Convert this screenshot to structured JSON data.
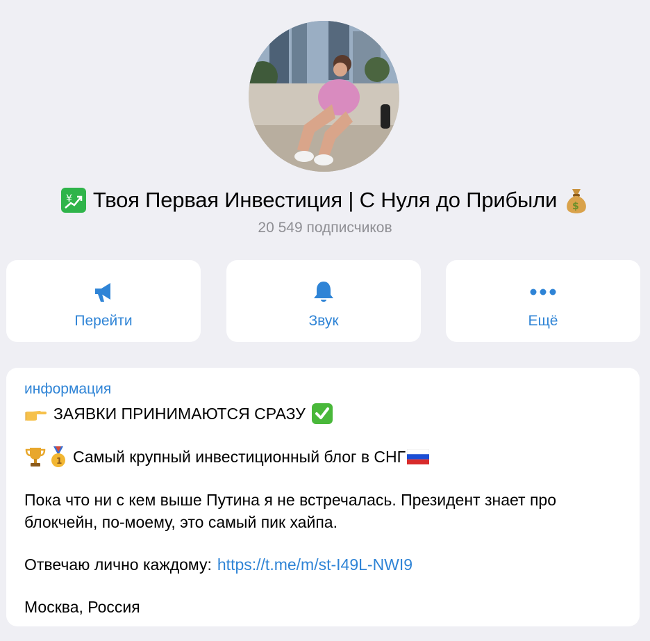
{
  "channel": {
    "title": "Твоя Первая Инвестиция | С Нуля до Прибыли",
    "title_prefix_icon": "chart-yen-up-icon",
    "title_suffix_icon": "money-bag-icon",
    "subscribers": "20 549 подписчиков"
  },
  "actions": [
    {
      "label": "Перейти",
      "icon": "megaphone-icon"
    },
    {
      "label": "Звук",
      "icon": "bell-icon"
    },
    {
      "label": "Ещё",
      "icon": "more-dots-icon"
    }
  ],
  "info": {
    "label": "информация",
    "line1": "ЗАЯВКИ ПРИНИМАЮТСЯ СРАЗУ",
    "line2": "Самый крупный инвестиционный блог в СНГ",
    "line3": "Пока что ни с кем выше Путина я не встречалась. Президент знает про блокчейн, по-моему, это самый пик хайпа.",
    "line4_text": "Отвечаю лично каждому:",
    "line4_link": "https://t.me/m/st-I49L-NWI9",
    "line5": "Москва, Россия"
  },
  "colors": {
    "background": "#efeff4",
    "card": "#ffffff",
    "accent": "#2f84d6",
    "secondary_text": "#8e8e93"
  }
}
